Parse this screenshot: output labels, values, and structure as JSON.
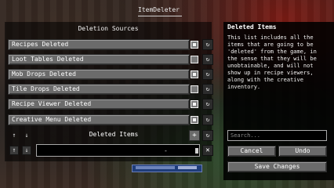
{
  "window": {
    "title": "ItemDeleter"
  },
  "sources": {
    "heading": "Deletion Sources",
    "items": [
      {
        "label": "Recipes Deleted",
        "checked": true
      },
      {
        "label": "Loot Tables Deleted",
        "checked": false
      },
      {
        "label": "Mob Drops Deleted",
        "checked": true
      },
      {
        "label": "Tile Drops Deleted",
        "checked": false
      },
      {
        "label": "Recipe Viewer Deleted",
        "checked": true
      },
      {
        "label": "Creative Menu Deleted",
        "checked": true
      }
    ],
    "reset_glyph": "↻"
  },
  "deleted_items": {
    "heading": "Deleted Items",
    "up_glyph": "↑",
    "down_glyph": "↓",
    "add_glyph": "+",
    "remove_glyph": "✕",
    "entry_dash": "-"
  },
  "sidebar": {
    "title": "Deleted Items",
    "description": "This list includes all the items that are going to be 'deleted' from the game, in the sense that they will be unobtainable, and will not show up in recipe viewers, along with the creative inventory.",
    "search_placeholder": "Search...",
    "cancel_label": "Cancel",
    "undo_label": "Undo",
    "save_label": "Save Changes"
  }
}
